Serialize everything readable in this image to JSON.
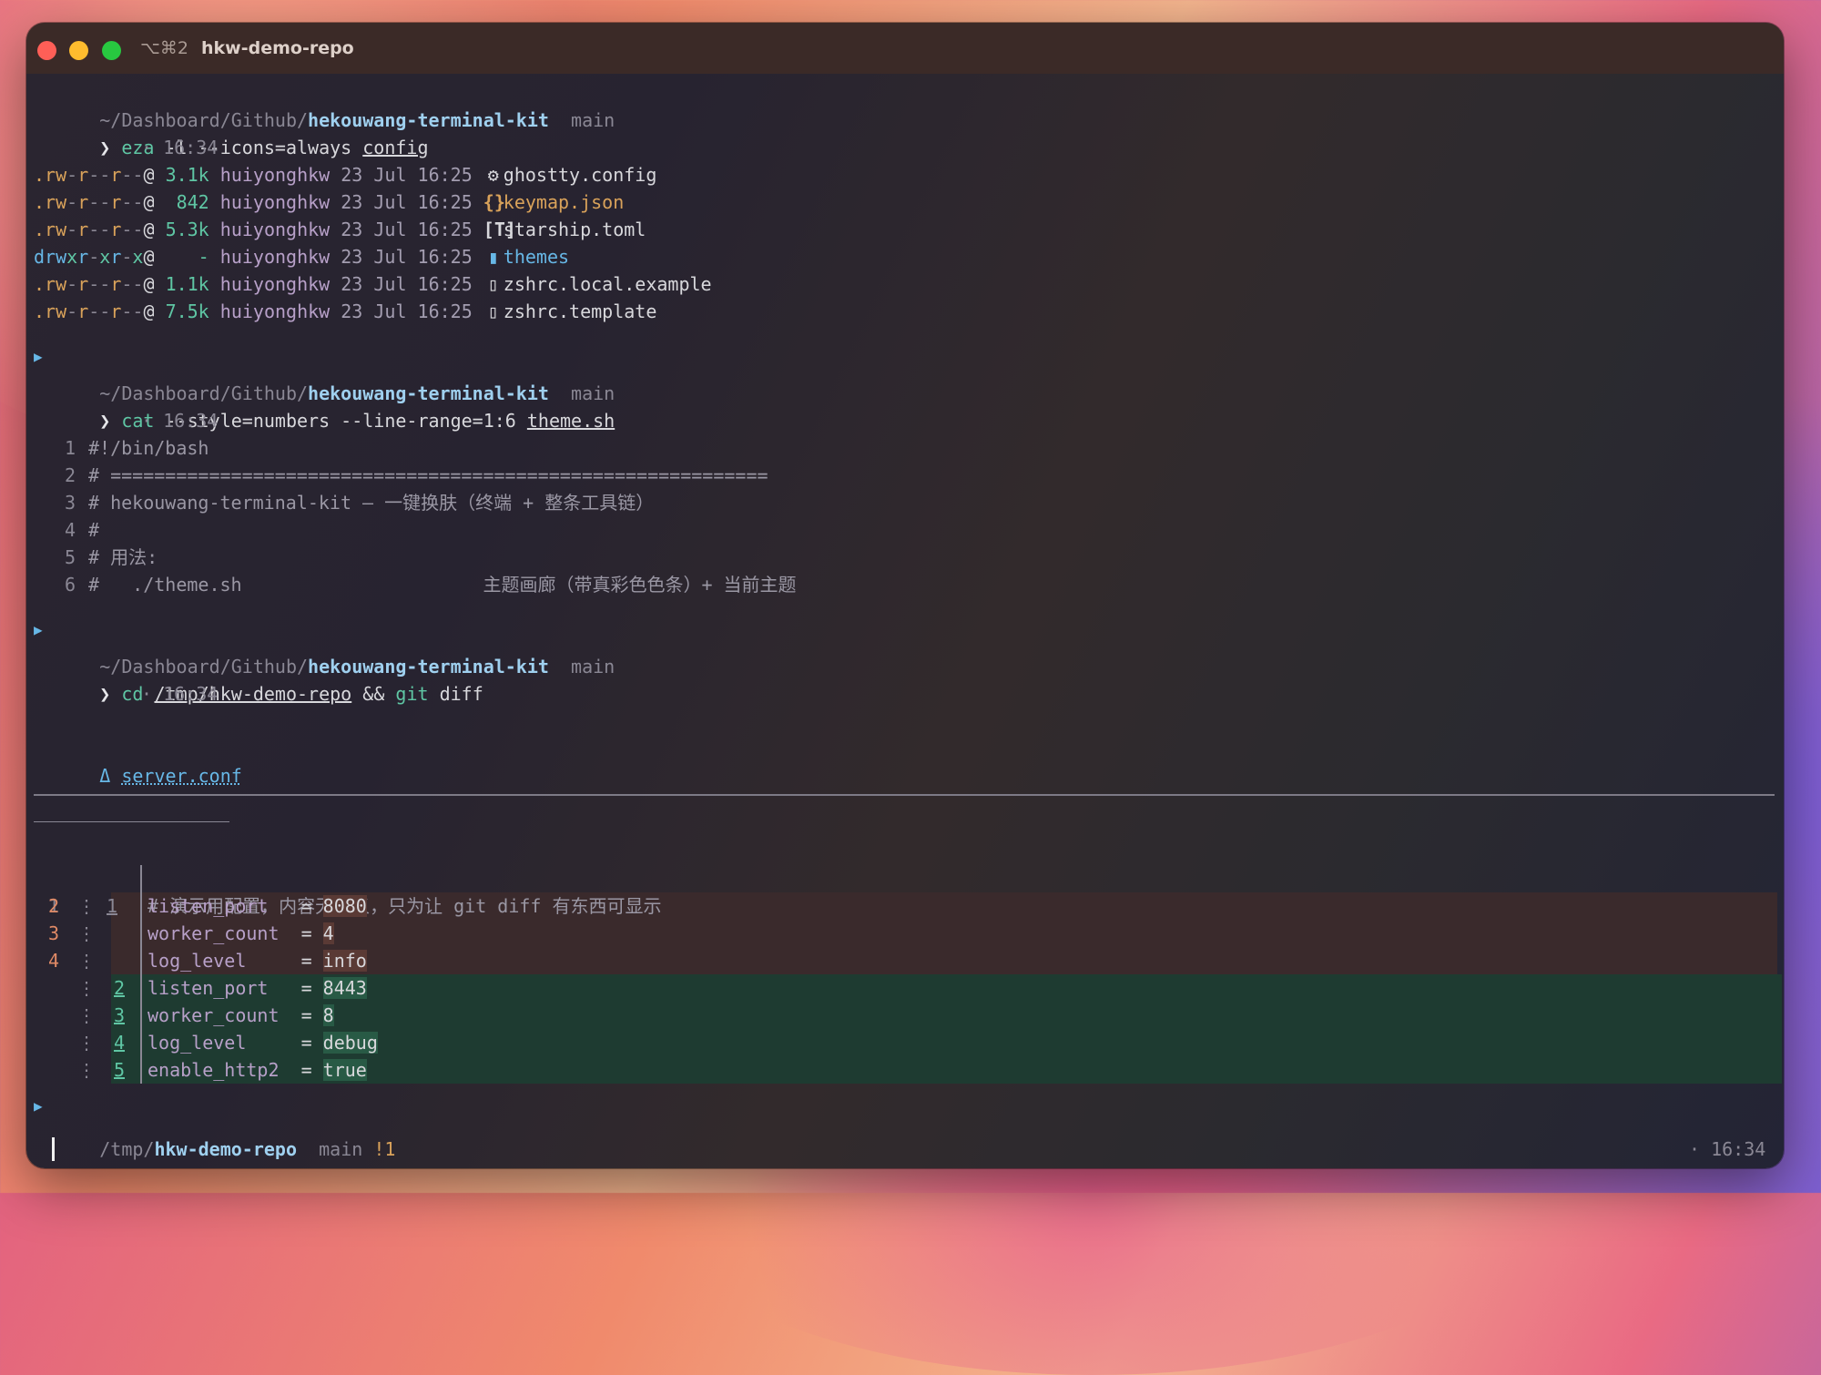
{
  "window": {
    "shortcut": "⌥⌘2",
    "title": "hkw-demo-repo"
  },
  "prompt1": {
    "path_prefix": "~/Dashboard/Github/",
    "repo": "hekouwang-terminal-kit",
    "branch": "main",
    "chevron": "❯",
    "command": "eza",
    "args": " -l --icons=always ",
    "arg_target": "config",
    "time": "· 16:34"
  },
  "listing": [
    {
      "perm_prefix": ".",
      "perm": "rw-r--r--",
      "flag": "@",
      "size": "3.1k",
      "user": "huiyonghkw",
      "date": "23 Jul 16:25",
      "icon": "gear-file-icon",
      "glyph": "⚙",
      "name": "ghostty.config",
      "kind": "file"
    },
    {
      "perm_prefix": ".",
      "perm": "rw-r--r--",
      "flag": "@",
      "size": " 842",
      "user": "huiyonghkw",
      "date": "23 Jul 16:25",
      "icon": "json-icon",
      "glyph": "{}",
      "name": "keymap.json",
      "kind": "json"
    },
    {
      "perm_prefix": ".",
      "perm": "rw-r--r--",
      "flag": "@",
      "size": "5.3k",
      "user": "huiyonghkw",
      "date": "23 Jul 16:25",
      "icon": "toml-icon",
      "glyph": "[T]",
      "name": "starship.toml",
      "kind": "file"
    },
    {
      "perm_prefix": "d",
      "perm": "rwxr-xr-x",
      "flag": "@",
      "size": "   -",
      "user": "huiyonghkw",
      "date": "23 Jul 16:25",
      "icon": "folder-icon",
      "glyph": "▮",
      "name": "themes",
      "kind": "dir"
    },
    {
      "perm_prefix": ".",
      "perm": "rw-r--r--",
      "flag": "@",
      "size": "1.1k",
      "user": "huiyonghkw",
      "date": "23 Jul 16:25",
      "icon": "file-icon",
      "glyph": "▯",
      "name": "zshrc.local.example",
      "kind": "file"
    },
    {
      "perm_prefix": ".",
      "perm": "rw-r--r--",
      "flag": "@",
      "size": "7.5k",
      "user": "huiyonghkw",
      "date": "23 Jul 16:25",
      "icon": "file-icon",
      "glyph": "▯",
      "name": "zshrc.template",
      "kind": "file"
    }
  ],
  "prompt2": {
    "path_prefix": "~/Dashboard/Github/",
    "repo": "hekouwang-terminal-kit",
    "branch": "main",
    "command": "cat",
    "args": " --style=numbers --line-range=1:6 ",
    "arg_target": "theme.sh",
    "time": "· 16:34"
  },
  "cat_lines": [
    {
      "n": "1",
      "text": "#!/bin/bash"
    },
    {
      "n": "2",
      "text": "# ============================================================"
    },
    {
      "n": "3",
      "text": "# hekouwang-terminal-kit — 一键换肤（终端 + 整条工具链）"
    },
    {
      "n": "4",
      "text": "#"
    },
    {
      "n": "5",
      "text": "# 用法:"
    },
    {
      "n": "6",
      "text": "#   ./theme.sh                      主题画廊（带真彩色色条）+ 当前主题"
    }
  ],
  "prompt3": {
    "path_prefix": "~/Dashboard/Github/",
    "repo": "hekouwang-terminal-kit",
    "branch": "main",
    "command": "cd",
    "arg_target": "/tmp/hkw-demo-repo",
    "joiner": " && ",
    "command2": "git",
    "args2": " diff",
    "time": "· 16:34"
  },
  "diff": {
    "delta_symbol": "Δ",
    "file": "server.conf",
    "context_line": {
      "old": "1",
      "new": "1",
      "text": "# 演示用配置，内容无意义，只为让 git diff 有东西可显示"
    },
    "removed": [
      {
        "old": "2",
        "key": "listen_port  ",
        "eq": " = ",
        "val": "8080"
      },
      {
        "old": "3",
        "key": "worker_count ",
        "eq": " = ",
        "val": "4"
      },
      {
        "old": "4",
        "key": "log_level    ",
        "eq": " = ",
        "val": "info"
      }
    ],
    "added": [
      {
        "new": "2",
        "key": "listen_port  ",
        "eq": " = ",
        "val": "8443"
      },
      {
        "new": "3",
        "key": "worker_count ",
        "eq": " = ",
        "val": "8"
      },
      {
        "new": "4",
        "key": "log_level    ",
        "eq": " = ",
        "val": "debug"
      },
      {
        "new": "5",
        "key": "enable_http2 ",
        "eq": " = ",
        "val": "true"
      }
    ]
  },
  "prompt4": {
    "path_prefix": "/tmp/",
    "repo": "hkw-demo-repo",
    "branch": "main",
    "status": "!1",
    "chevron": "❯",
    "time": "· 16:34"
  },
  "colors": {
    "accent_blue": "#67b7e6",
    "accent_green": "#5fc6a4",
    "accent_orange": "#d9a25a",
    "removed_bg": "#3a2a2c",
    "added_bg": "#1e3b31"
  }
}
